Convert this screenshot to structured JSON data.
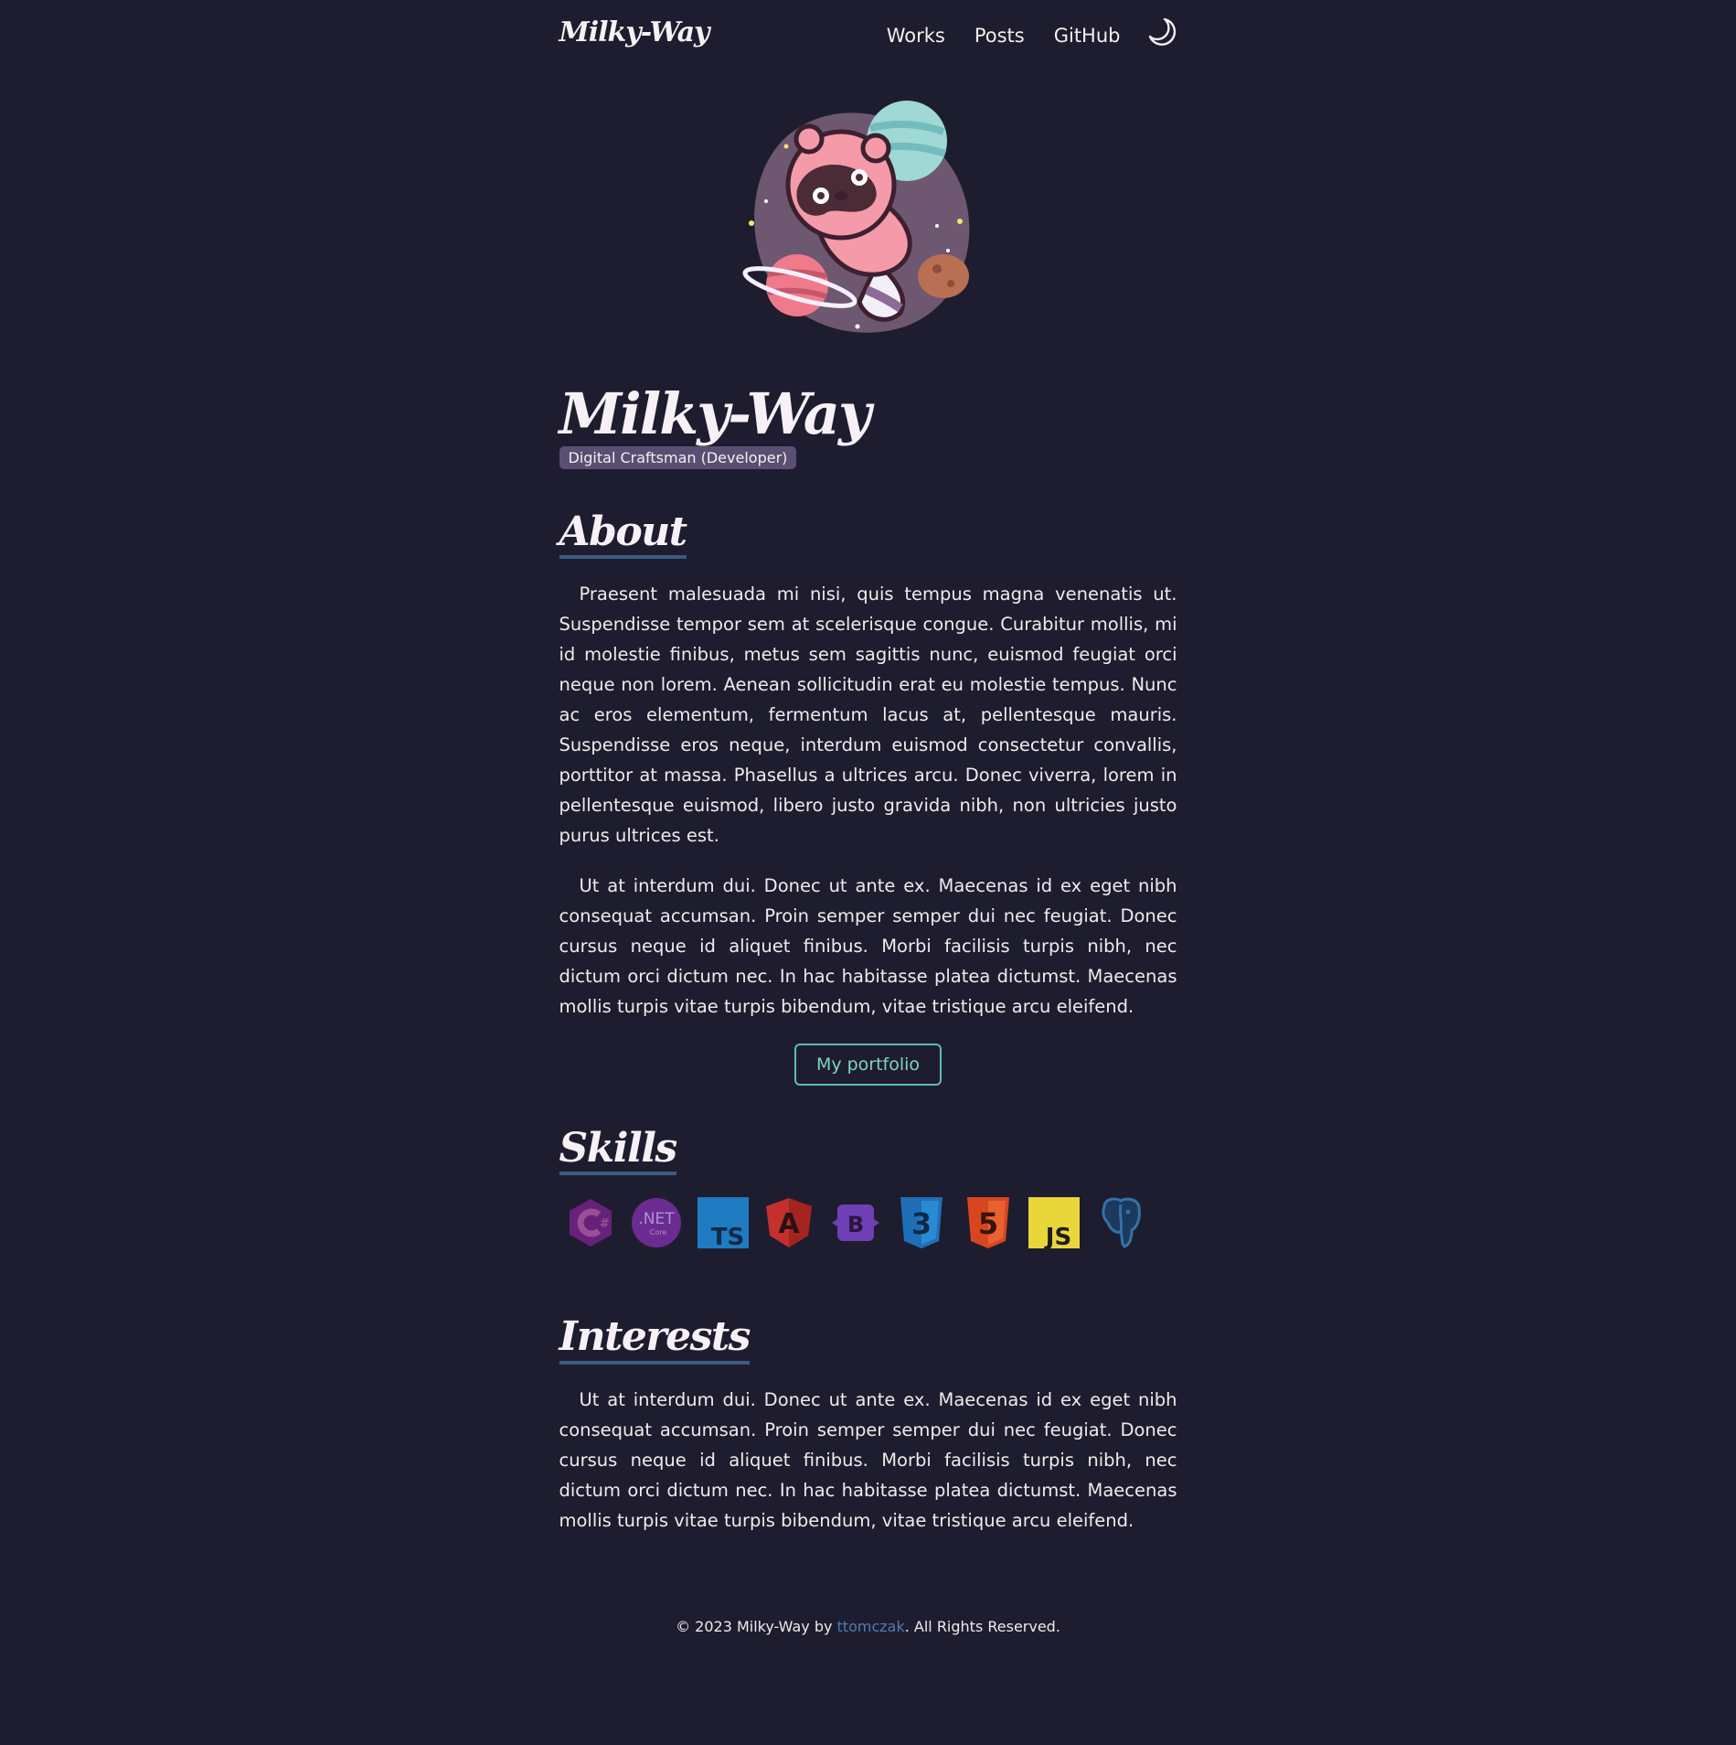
{
  "header": {
    "brand": "Milky-Way",
    "nav": [
      "Works",
      "Posts",
      "GitHub"
    ],
    "theme_icon": "moon-icon"
  },
  "hero": {
    "avatar_icon": "raccoon-astronaut-illustration",
    "title": "Milky-Way",
    "subtitle": "Digital Craftsman (Developer)"
  },
  "about": {
    "heading": "About",
    "paragraphs": [
      "Praesent malesuada mi nisi, quis tempus magna venenatis ut. Suspendisse tempor sem at scelerisque congue. Curabitur mollis, mi id molestie finibus, metus sem sagittis nunc, euismod feugiat orci neque non lorem. Aenean sollicitudin erat eu molestie tempus. Nunc ac eros elementum, fermentum lacus at, pellentesque mauris. Suspendisse eros neque, interdum euismod consectetur convallis, porttitor at massa. Phasellus a ultrices arcu. Donec viverra, lorem in pellentesque euismod, libero justo gravida nibh, non ultricies justo purus ultrices est.",
      "Ut at interdum dui. Donec ut ante ex. Maecenas id ex eget nibh consequat accumsan. Proin semper semper dui nec feugiat. Donec cursus neque id aliquet finibus. Morbi facilisis turpis nibh, nec dictum orci dictum nec. In hac habitasse platea dictumst. Maecenas mollis turpis vitae turpis bibendum, vitae tristique arcu eleifend."
    ],
    "button": "My portfolio"
  },
  "skills": {
    "heading": "Skills",
    "icons": [
      {
        "name": "csharp-icon",
        "label": "#"
      },
      {
        "name": "dotnet-core-icon",
        "label": ".NET",
        "sub": "Core"
      },
      {
        "name": "typescript-icon",
        "label": "TS"
      },
      {
        "name": "angular-icon",
        "label": "A"
      },
      {
        "name": "bootstrap-icon",
        "label": "B"
      },
      {
        "name": "css3-icon",
        "label": "3"
      },
      {
        "name": "html5-icon",
        "label": "5"
      },
      {
        "name": "javascript-icon",
        "label": "JS"
      },
      {
        "name": "postgresql-icon",
        "label": ""
      }
    ]
  },
  "interests": {
    "heading": "Interests",
    "paragraph": "Ut at interdum dui. Donec ut ante ex. Maecenas id ex eget nibh consequat accumsan. Proin semper semper dui nec feugiat. Donec cursus neque id aliquet finibus. Morbi facilisis turpis nibh, nec dictum orci dictum nec. In hac habitasse platea dictumst. Maecenas mollis turpis vitae turpis bibendum, vitae tristique arcu eleifend."
  },
  "footer": {
    "prefix": "© 2023 Milky-Way by ",
    "author": "ttomczak",
    "suffix": ". All Rights Reserved."
  },
  "colors": {
    "background": "#1e1d2f",
    "heading_underline": "#3b5b85",
    "badge": "#5a4f72",
    "button_accent": "#5bbfb1",
    "link": "#4e7db3"
  }
}
